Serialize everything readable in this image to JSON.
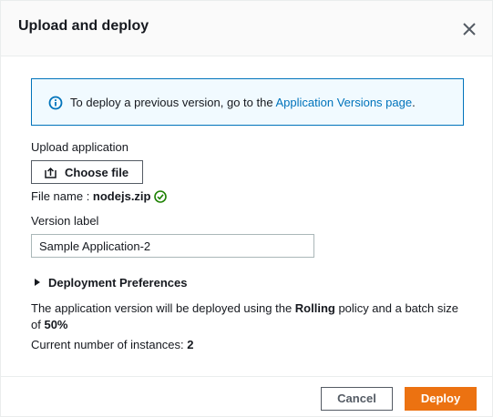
{
  "dialog": {
    "title": "Upload and deploy",
    "close_icon": "close-icon"
  },
  "info": {
    "icon": "info-icon",
    "text": "To deploy a previous version, go to the ",
    "link": "Application Versions page",
    "suffix": "."
  },
  "upload": {
    "label": "Upload application",
    "button_label": "Choose file",
    "button_icon": "upload-icon",
    "file_name_label": "File name : ",
    "file_name": "nodejs.zip",
    "status_icon": "check-circle-icon"
  },
  "version": {
    "label": "Version label",
    "value": "Sample Application-2"
  },
  "preferences": {
    "label": "Deployment Preferences",
    "expanded": false
  },
  "policy": {
    "prefix": "The application version will be deployed using the ",
    "policy_name": "Rolling",
    "middle": " policy and a batch size of ",
    "batch_size": "50%"
  },
  "instances": {
    "label": "Current number of instances: ",
    "count": "2"
  },
  "footer": {
    "cancel_label": "Cancel",
    "deploy_label": "Deploy"
  },
  "colors": {
    "accent": "#ec7211",
    "link": "#0073bb",
    "success": "#1d8102",
    "info_bg": "#f1faff"
  }
}
